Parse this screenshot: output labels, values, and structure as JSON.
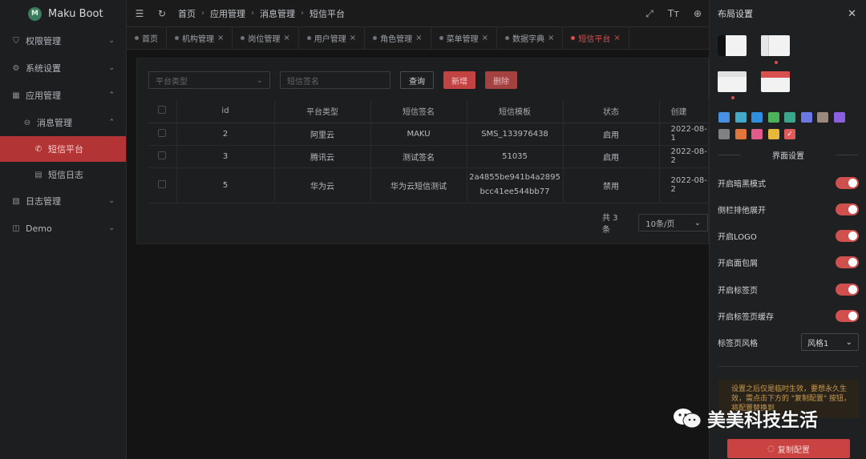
{
  "app": {
    "name": "Maku Boot",
    "logo_letter": "M"
  },
  "sidebar": {
    "items": [
      {
        "label": "权限管理",
        "icon": "shield-icon"
      },
      {
        "label": "系统设置",
        "icon": "gear-icon"
      },
      {
        "label": "应用管理",
        "icon": "grid-icon"
      },
      {
        "label": "消息管理",
        "icon": "message-icon"
      },
      {
        "label": "短信平台",
        "icon": "phone-icon"
      },
      {
        "label": "短信日志",
        "icon": "doc-icon"
      },
      {
        "label": "日志管理",
        "icon": "log-icon"
      },
      {
        "label": "Demo",
        "icon": "demo-icon"
      }
    ]
  },
  "header": {
    "breadcrumbs": [
      "首页",
      "应用管理",
      "消息管理",
      "短信平台"
    ]
  },
  "tabs": [
    {
      "label": "首页"
    },
    {
      "label": "机构管理"
    },
    {
      "label": "岗位管理"
    },
    {
      "label": "用户管理"
    },
    {
      "label": "角色管理"
    },
    {
      "label": "菜单管理"
    },
    {
      "label": "数据字典"
    },
    {
      "label": "短信平台"
    }
  ],
  "filters": {
    "platform_placeholder": "平台类型",
    "sign_placeholder": "短信签名",
    "query_label": "查询",
    "add_label": "新增",
    "delete_label": "删除"
  },
  "table": {
    "headers": [
      "id",
      "平台类型",
      "短信签名",
      "短信模板",
      "状态",
      "创建"
    ],
    "rows": [
      {
        "id": "2",
        "platform": "阿里云",
        "sign": "MAKU",
        "template1": "SMS_133976438",
        "template2": "",
        "status": "启用",
        "created": "2022-08-1"
      },
      {
        "id": "3",
        "platform": "腾讯云",
        "sign": "测试签名",
        "template1": "51035",
        "template2": "",
        "status": "启用",
        "created": "2022-08-2"
      },
      {
        "id": "5",
        "platform": "华为云",
        "sign": "华为云短信测试",
        "template1": "2a4855be941b4a2895",
        "template2": "bcc41ee544bb77",
        "status": "禁用",
        "created": "2022-08-2"
      }
    ]
  },
  "pagination": {
    "total": "共 3 条",
    "page_size": "10条/页"
  },
  "drawer": {
    "title": "布局设置",
    "swatches": [
      "#4a90e2",
      "#44a8c9",
      "#2f8ee0",
      "#4bb35c",
      "#3aa68c",
      "#6b78e5",
      "#9a8a7e",
      "#8c5ee0",
      "#7f8283",
      "#e0763a",
      "#e05a8c",
      "#e6b83a",
      "#e05a5a"
    ],
    "section_title": "界面设置",
    "options": [
      {
        "label": "开启暗黑模式",
        "on": true
      },
      {
        "label": "侧栏排他展开",
        "on": true
      },
      {
        "label": "开启LOGO",
        "on": true
      },
      {
        "label": "开启面包屑",
        "on": true
      },
      {
        "label": "开启标签页",
        "on": true
      },
      {
        "label": "开启标签页缓存",
        "on": true
      }
    ],
    "tab_style_label": "标签页风格",
    "tab_style_value": "风格1",
    "notice": "设置之后仅是临时生效，要想永久生效，需点击下方的 \"复制配置\" 按钮，将配置替换到",
    "copy_label": "复制配置"
  },
  "watermark": {
    "text": "美美科技生活"
  }
}
